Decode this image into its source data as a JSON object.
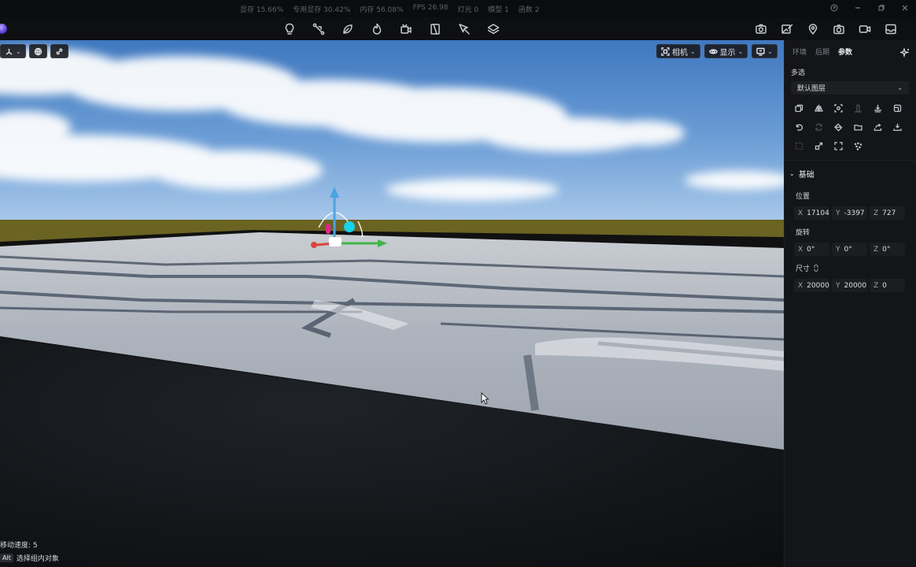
{
  "stats": [
    "显存 15.66%",
    "专用显存 30.42%",
    "内存 56.08%",
    "FPS 26.98",
    "灯光 0",
    "模型 1",
    "函数 2"
  ],
  "viewport": {
    "camera_label": "相机",
    "display_label": "显示",
    "move_speed": "移动速度: 5",
    "select_key": "Alt",
    "select_hint": "选择组内对象"
  },
  "panel": {
    "tabs": [
      "环境",
      "后期",
      "参数"
    ],
    "multi_select": "多选",
    "layer_value": "默认图层",
    "basic_section": "基础",
    "position_label": "位置",
    "position": {
      "x": "17104",
      "y": "-3397",
      "z": "727"
    },
    "rotation_label": "旋转",
    "rotation": {
      "x": "0°",
      "y": "0°",
      "z": "0°"
    },
    "size_label": "尺寸",
    "size": {
      "x": "20000",
      "y": "20000",
      "z": "0"
    }
  },
  "colors": {
    "sky_top": "#4f86c6",
    "horizon_ground": "#6e6520",
    "terrain": "#b9bec6",
    "gizmo_up": "#4ba3df",
    "gizmo_x": "#d9453a",
    "gizmo_y": "#43b549",
    "gizmo_cyan": "#18d1ea",
    "gizmo_magenta": "#e0268f"
  }
}
